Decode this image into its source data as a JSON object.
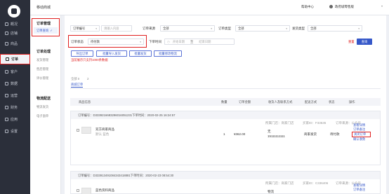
{
  "sidebar": {
    "items": [
      {
        "label": "概况",
        "icon": "home-icon"
      },
      {
        "label": "店铺",
        "icon": "store-icon"
      },
      {
        "label": "商品",
        "icon": "goods-icon"
      },
      {
        "label": "订单",
        "icon": "order-icon"
      },
      {
        "label": "客户",
        "icon": "user-icon"
      },
      {
        "label": "数据",
        "icon": "chart-icon"
      },
      {
        "label": "运营",
        "icon": "operation-icon"
      },
      {
        "label": "财务",
        "icon": "finance-icon"
      },
      {
        "label": "应用",
        "icon": "apps-icon"
      },
      {
        "label": "设置",
        "icon": "gear-icon"
      }
    ]
  },
  "topbar": {
    "title": "移动商城",
    "right_1": "帮助中心",
    "right_2": "政府城零售版",
    "user_label": "用户"
  },
  "subsidebar": {
    "group1": "订单管理",
    "active": "订单查询",
    "group2": "订单处理",
    "items2": [
      "发货管理",
      "售后管理",
      "评价管理"
    ],
    "group3": "物流配送",
    "items3": [
      "物流发货",
      "电子面单"
    ]
  },
  "filters": {
    "order_no_select": "订单编号",
    "order_no_placeholder": "请输入内容",
    "order_source_label": "订单来源",
    "order_source_value": "全部",
    "order_type_label": "订单类型",
    "order_type_value": "全部",
    "ship_type_label": "发货类型",
    "ship_type_value": "全部",
    "status_label": "订单状态",
    "status_value": "待付款",
    "time_label": "下单时间",
    "start_placeholder": "开始日期",
    "end_placeholder": "结束日期",
    "to": "至",
    "reset": "重置",
    "search": "查询"
  },
  "actions": {
    "export": "导出订单",
    "batch_ship": "批量导入发货",
    "batch_send": "批量发货",
    "batch_change": "批量修改物流"
  },
  "warning": "当前展示只支持1000条数据",
  "tabs": {
    "all": "全部",
    "all_count": "0",
    "second": "商城订单",
    "second_count": "2"
  },
  "table_headers": [
    "商品信息",
    "数量",
    "订单金额",
    "收货人及联系方式",
    "配送方式",
    "状态",
    "操作"
  ],
  "orders": [
    {
      "header": "订单编号：D3339216683296016051231下单时间：2020-02-25 16:24:57",
      "shop": "所属门店：商家门店",
      "buyer": "买家ID：F33636",
      "buyer_name": "订单来源：公众号",
      "product": "双方商家商品",
      "spec": "默认 蓝色",
      "qty": "1",
      "amount": "¥362.00",
      "receiver": "无",
      "phone": "15111111111",
      "delivery": "商家发货",
      "status": "待付款",
      "ops": [
        "查看详情",
        "订单备注",
        "关闭订单",
        "确认收款"
      ]
    },
    {
      "header": "订单编号：D333913491084343418881下单时间：2020-02-23 08:54:30",
      "shop": "所属门店：商家门店",
      "buyer": "买家ID：C336406",
      "buyer_name": "订单来源：公众号",
      "product": "蓝色资料商品",
      "spec": "",
      "qty": "",
      "amount": "",
      "receiver": "物流",
      "phone": "",
      "delivery": "",
      "status": "",
      "ops": [
        "查看详情",
        "订单备注"
      ]
    }
  ],
  "colors": {
    "sidebar_bg": "#2b2f3a",
    "accent": "#3658c9",
    "highlight": "#e02020"
  }
}
